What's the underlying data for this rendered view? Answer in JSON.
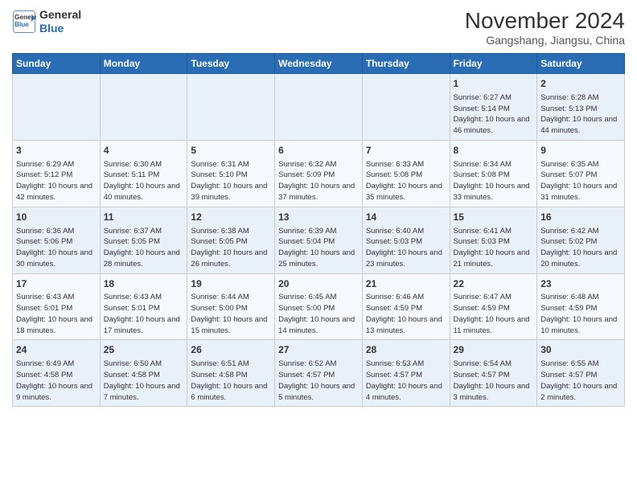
{
  "logo": {
    "line1": "General",
    "line2": "Blue"
  },
  "title": "November 2024",
  "subtitle": "Gangshang, Jiangsu, China",
  "weekdays": [
    "Sunday",
    "Monday",
    "Tuesday",
    "Wednesday",
    "Thursday",
    "Friday",
    "Saturday"
  ],
  "rows": [
    [
      {
        "day": "",
        "info": ""
      },
      {
        "day": "",
        "info": ""
      },
      {
        "day": "",
        "info": ""
      },
      {
        "day": "",
        "info": ""
      },
      {
        "day": "",
        "info": ""
      },
      {
        "day": "1",
        "info": "Sunrise: 6:27 AM\nSunset: 5:14 PM\nDaylight: 10 hours and 46 minutes."
      },
      {
        "day": "2",
        "info": "Sunrise: 6:28 AM\nSunset: 5:13 PM\nDaylight: 10 hours and 44 minutes."
      }
    ],
    [
      {
        "day": "3",
        "info": "Sunrise: 6:29 AM\nSunset: 5:12 PM\nDaylight: 10 hours and 42 minutes."
      },
      {
        "day": "4",
        "info": "Sunrise: 6:30 AM\nSunset: 5:11 PM\nDaylight: 10 hours and 40 minutes."
      },
      {
        "day": "5",
        "info": "Sunrise: 6:31 AM\nSunset: 5:10 PM\nDaylight: 10 hours and 39 minutes."
      },
      {
        "day": "6",
        "info": "Sunrise: 6:32 AM\nSunset: 5:09 PM\nDaylight: 10 hours and 37 minutes."
      },
      {
        "day": "7",
        "info": "Sunrise: 6:33 AM\nSunset: 5:08 PM\nDaylight: 10 hours and 35 minutes."
      },
      {
        "day": "8",
        "info": "Sunrise: 6:34 AM\nSunset: 5:08 PM\nDaylight: 10 hours and 33 minutes."
      },
      {
        "day": "9",
        "info": "Sunrise: 6:35 AM\nSunset: 5:07 PM\nDaylight: 10 hours and 31 minutes."
      }
    ],
    [
      {
        "day": "10",
        "info": "Sunrise: 6:36 AM\nSunset: 5:06 PM\nDaylight: 10 hours and 30 minutes."
      },
      {
        "day": "11",
        "info": "Sunrise: 6:37 AM\nSunset: 5:05 PM\nDaylight: 10 hours and 28 minutes."
      },
      {
        "day": "12",
        "info": "Sunrise: 6:38 AM\nSunset: 5:05 PM\nDaylight: 10 hours and 26 minutes."
      },
      {
        "day": "13",
        "info": "Sunrise: 6:39 AM\nSunset: 5:04 PM\nDaylight: 10 hours and 25 minutes."
      },
      {
        "day": "14",
        "info": "Sunrise: 6:40 AM\nSunset: 5:03 PM\nDaylight: 10 hours and 23 minutes."
      },
      {
        "day": "15",
        "info": "Sunrise: 6:41 AM\nSunset: 5:03 PM\nDaylight: 10 hours and 21 minutes."
      },
      {
        "day": "16",
        "info": "Sunrise: 6:42 AM\nSunset: 5:02 PM\nDaylight: 10 hours and 20 minutes."
      }
    ],
    [
      {
        "day": "17",
        "info": "Sunrise: 6:43 AM\nSunset: 5:01 PM\nDaylight: 10 hours and 18 minutes."
      },
      {
        "day": "18",
        "info": "Sunrise: 6:43 AM\nSunset: 5:01 PM\nDaylight: 10 hours and 17 minutes."
      },
      {
        "day": "19",
        "info": "Sunrise: 6:44 AM\nSunset: 5:00 PM\nDaylight: 10 hours and 15 minutes."
      },
      {
        "day": "20",
        "info": "Sunrise: 6:45 AM\nSunset: 5:00 PM\nDaylight: 10 hours and 14 minutes."
      },
      {
        "day": "21",
        "info": "Sunrise: 6:46 AM\nSunset: 4:59 PM\nDaylight: 10 hours and 13 minutes."
      },
      {
        "day": "22",
        "info": "Sunrise: 6:47 AM\nSunset: 4:59 PM\nDaylight: 10 hours and 11 minutes."
      },
      {
        "day": "23",
        "info": "Sunrise: 6:48 AM\nSunset: 4:59 PM\nDaylight: 10 hours and 10 minutes."
      }
    ],
    [
      {
        "day": "24",
        "info": "Sunrise: 6:49 AM\nSunset: 4:58 PM\nDaylight: 10 hours and 9 minutes."
      },
      {
        "day": "25",
        "info": "Sunrise: 6:50 AM\nSunset: 4:58 PM\nDaylight: 10 hours and 7 minutes."
      },
      {
        "day": "26",
        "info": "Sunrise: 6:51 AM\nSunset: 4:58 PM\nDaylight: 10 hours and 6 minutes."
      },
      {
        "day": "27",
        "info": "Sunrise: 6:52 AM\nSunset: 4:57 PM\nDaylight: 10 hours and 5 minutes."
      },
      {
        "day": "28",
        "info": "Sunrise: 6:53 AM\nSunset: 4:57 PM\nDaylight: 10 hours and 4 minutes."
      },
      {
        "day": "29",
        "info": "Sunrise: 6:54 AM\nSunset: 4:57 PM\nDaylight: 10 hours and 3 minutes."
      },
      {
        "day": "30",
        "info": "Sunrise: 6:55 AM\nSunset: 4:57 PM\nDaylight: 10 hours and 2 minutes."
      }
    ]
  ]
}
